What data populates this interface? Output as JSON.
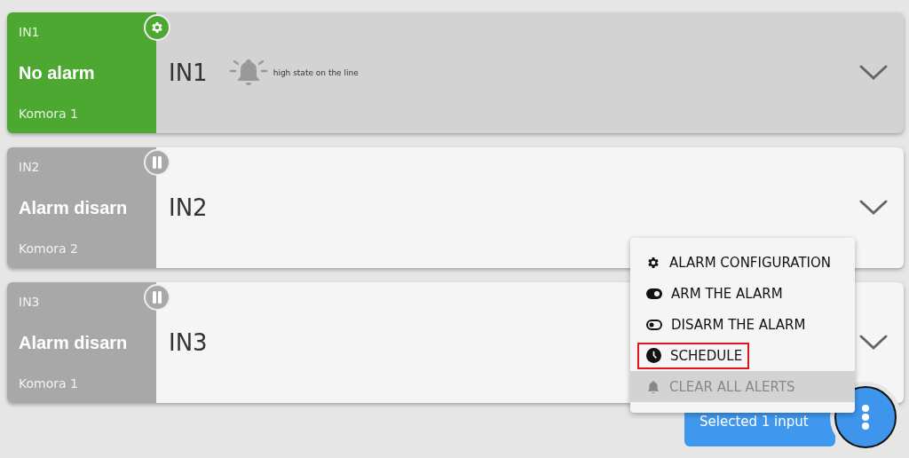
{
  "inputs": [
    {
      "code": "IN1",
      "status": "No alarm",
      "kind": "ok",
      "location": "Komora 1",
      "name": "IN1",
      "selected": true,
      "alert": "high state on the line"
    },
    {
      "code": "IN2",
      "status": "Alarm disarn",
      "kind": "disarmed",
      "location": "Komora 2",
      "name": "IN2",
      "selected": false
    },
    {
      "code": "IN3",
      "status": "Alarm disarn",
      "kind": "disarmed",
      "location": "Komora 1",
      "name": "IN3",
      "selected": false
    }
  ],
  "menu": {
    "items": [
      {
        "label": "ALARM CONFIGURATION",
        "disabled": false,
        "highlighted": false
      },
      {
        "label": "ARM THE ALARM",
        "disabled": false,
        "highlighted": false
      },
      {
        "label": "DISARM THE ALARM",
        "disabled": false,
        "highlighted": false
      },
      {
        "label": "SCHEDULE",
        "disabled": false,
        "highlighted": true
      },
      {
        "label": "CLEAR ALL ALERTS",
        "disabled": true,
        "highlighted": false
      }
    ]
  },
  "selection": {
    "label": "Selected 1 input"
  }
}
